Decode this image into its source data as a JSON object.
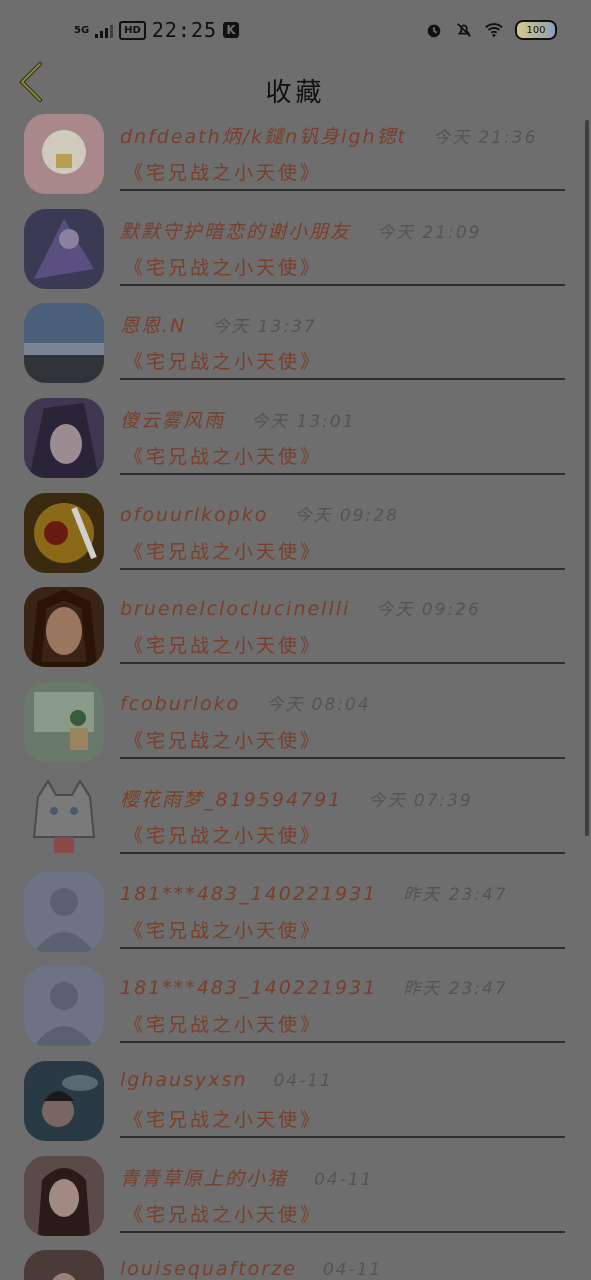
{
  "status_bar": {
    "signal": "5G",
    "hd": "HD",
    "time": "22:25",
    "k_badge": "K",
    "battery": "100"
  },
  "header": {
    "title": "收藏"
  },
  "items": [
    {
      "name": "dnfdeath炳/k鑓n钒身igh锶t",
      "time": "今天 21:36",
      "tag": "《宅兄战之小天使》"
    },
    {
      "name": "默默守护暗恋的谢小朋友",
      "time": "今天 21:09",
      "tag": "《宅兄战之小天使》"
    },
    {
      "name": "恩恩.N",
      "time": "今天 13:37",
      "tag": "《宅兄战之小天使》"
    },
    {
      "name": "傻云雾风雨",
      "time": "今天 13:01",
      "tag": "《宅兄战之小天使》"
    },
    {
      "name": "ofouurlkopko",
      "time": "今天 09:28",
      "tag": "《宅兄战之小天使》"
    },
    {
      "name": "bruenelcloclucinellli",
      "time": "今天 09:26",
      "tag": "《宅兄战之小天使》"
    },
    {
      "name": "fcoburloko",
      "time": "今天 08:04",
      "tag": "《宅兄战之小天使》"
    },
    {
      "name": "樱花雨梦_819594791",
      "time": "今天 07:39",
      "tag": "《宅兄战之小天使》"
    },
    {
      "name": "181***483_140221931",
      "time": "昨天 23:47",
      "tag": "《宅兄战之小天使》"
    },
    {
      "name": "181***483_140221931",
      "time": "昨天 23:47",
      "tag": "《宅兄战之小天使》"
    },
    {
      "name": "lghausyxsn",
      "time": "04-11",
      "tag": "《宅兄战之小天使》"
    },
    {
      "name": "青青草原上的小猪",
      "time": "04-11",
      "tag": "《宅兄战之小天使》"
    },
    {
      "name": "louisequaftorze",
      "time": "04-11",
      "tag": ""
    }
  ]
}
